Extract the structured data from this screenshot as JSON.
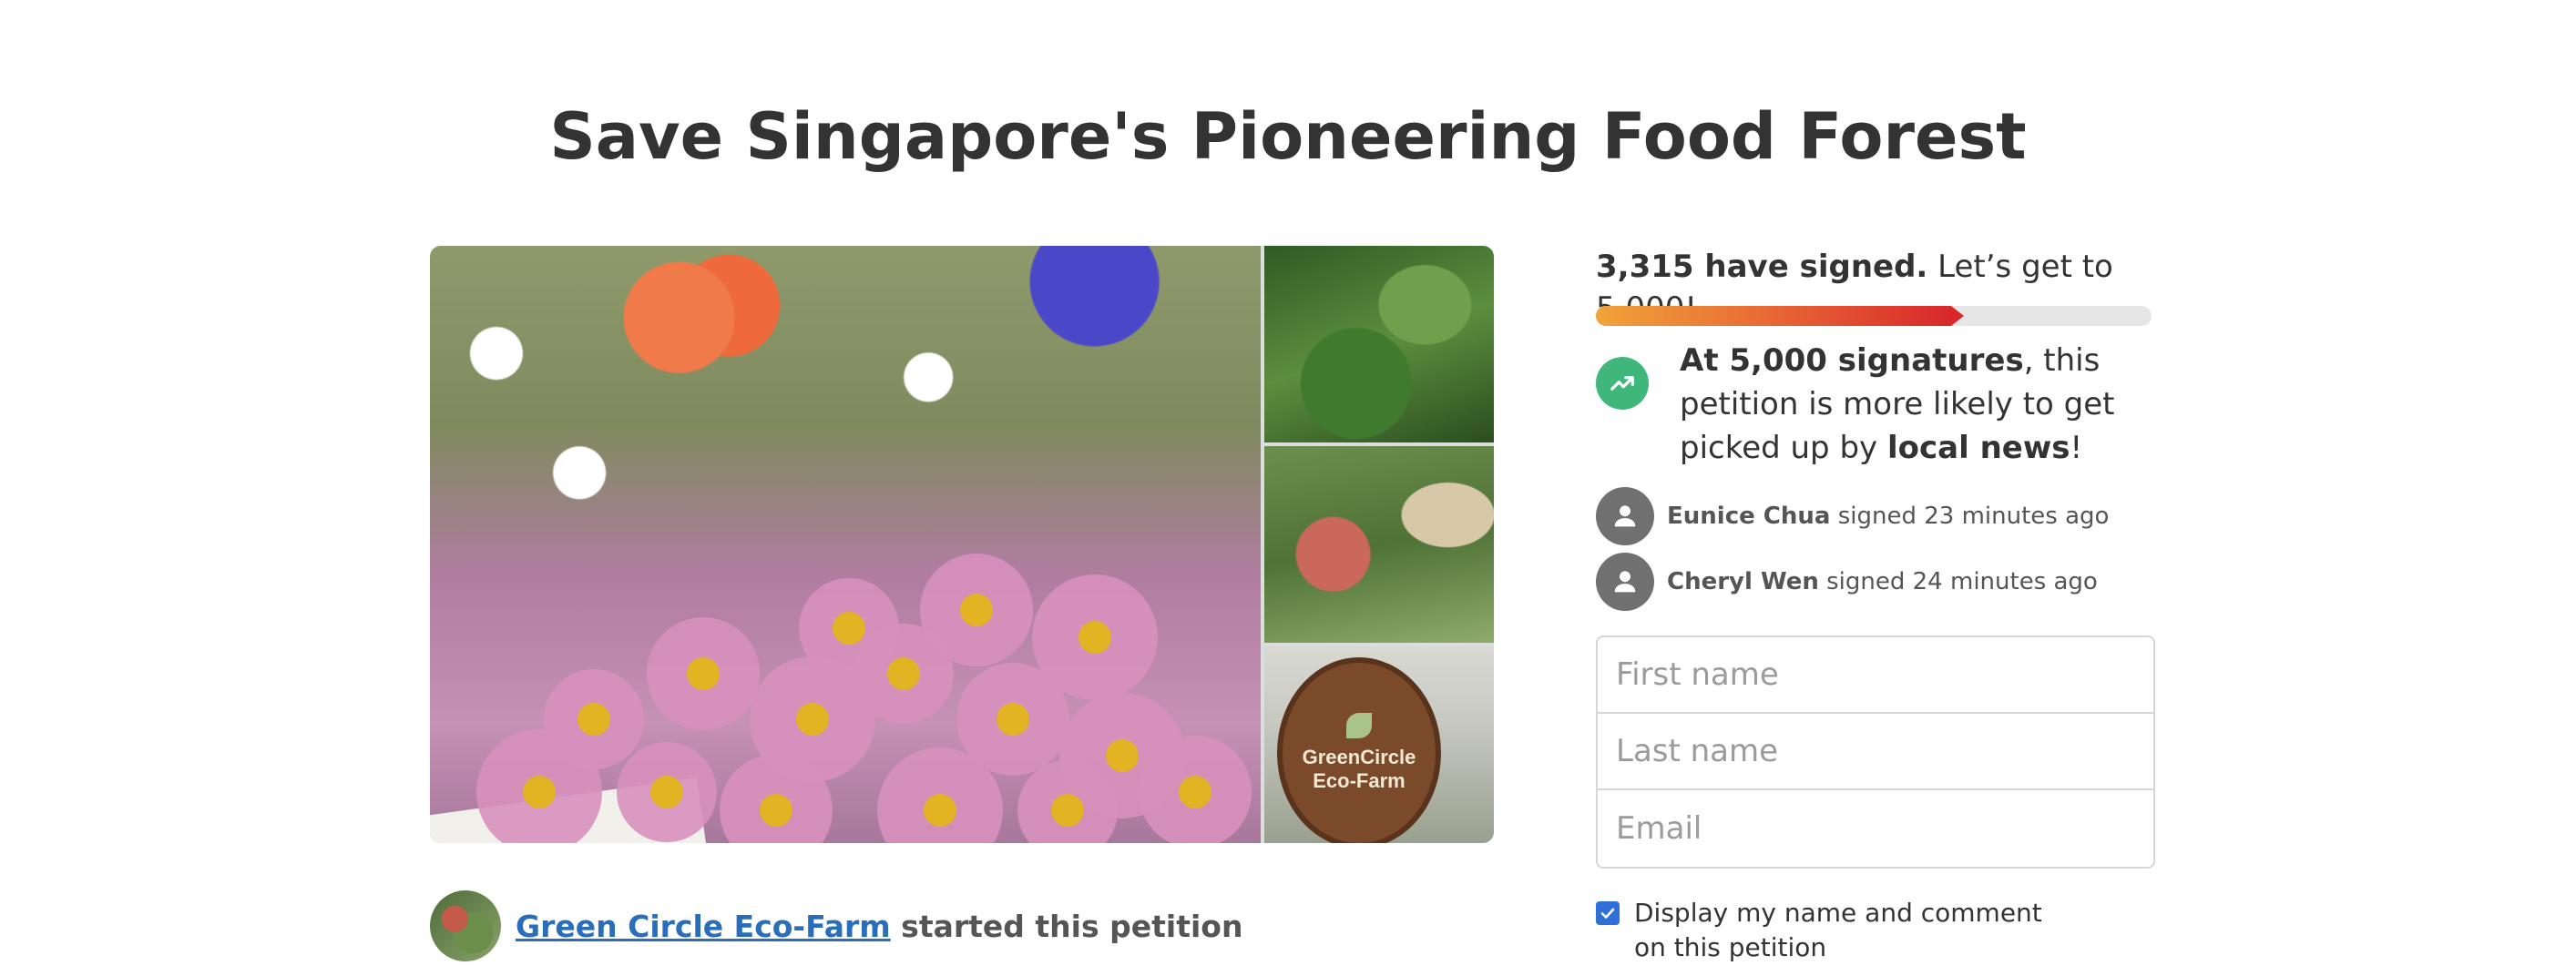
{
  "page_title": "Save Singapore's Pioneering Food Forest",
  "gallery": {
    "thumb3_sign_line1": "GreenCircle",
    "thumb3_sign_line2": "Eco-Farm"
  },
  "starter": {
    "org_name": "Green Circle Eco-Farm",
    "suffix": "started this petition"
  },
  "signatures": {
    "count_text": "3,315 have signed.",
    "goal_text": "Let’s get to 5,000!",
    "signed": 3315,
    "goal": 5000
  },
  "milestone": {
    "bold_1": "At 5,000 signatures",
    "text_1": ", this petition is more likely to get picked up by ",
    "bold_2": "local news",
    "text_2": "!"
  },
  "recent_signers": [
    {
      "name": "Eunice Chua",
      "action": "signed 23 minutes ago"
    },
    {
      "name": "Cheryl Wen",
      "action": "signed 24 minutes ago"
    }
  ],
  "form": {
    "first_name_placeholder": "First name",
    "last_name_placeholder": "Last name",
    "email_placeholder": "Email",
    "first_name_value": "",
    "last_name_value": "",
    "email_value": ""
  },
  "consent": {
    "checked": true,
    "label": "Display my name and comment on this petition"
  },
  "colors": {
    "link": "#2a6ebb",
    "progress_start": "#f0a43a",
    "progress_end": "#d8282b",
    "trend_green": "#3fb77a",
    "checkbox": "#2f6fd8"
  },
  "icons": {
    "milestone": "trending-up-icon",
    "signer_avatar": "person-icon",
    "consent_check": "check-icon"
  }
}
